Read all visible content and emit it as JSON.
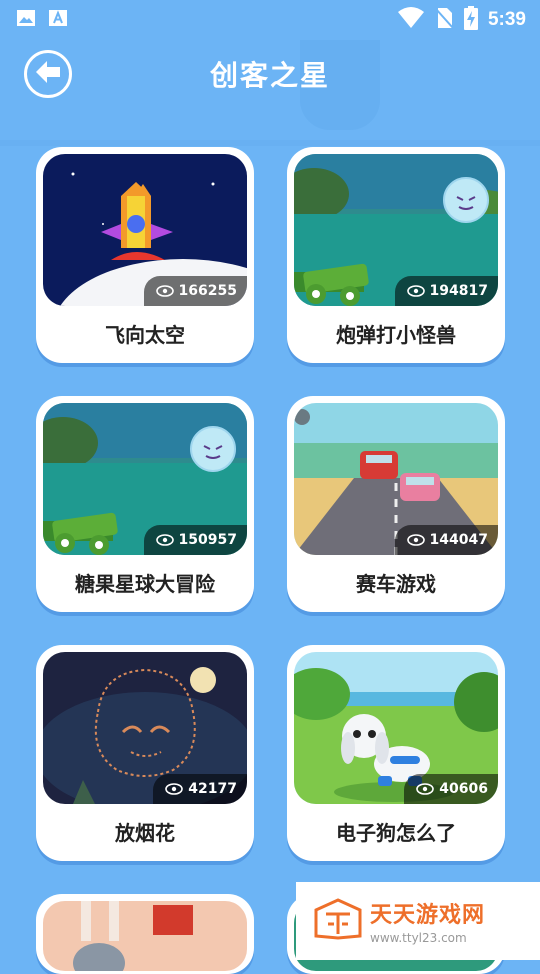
{
  "status_bar": {
    "time": "5:39"
  },
  "header": {
    "title": "创客之星"
  },
  "cards": [
    {
      "title": "飞向太空",
      "views": "166255"
    },
    {
      "title": "炮弹打小怪兽",
      "views": "194817"
    },
    {
      "title": "糖果星球大冒险",
      "views": "150957"
    },
    {
      "title": "赛车游戏",
      "views": "144047"
    },
    {
      "title": "放烟花",
      "views": "42177"
    },
    {
      "title": "电子狗怎么了",
      "views": "40606"
    }
  ],
  "watermark": {
    "title": "天天游戏网",
    "url": "www.ttyl23.com"
  },
  "colors": {
    "background": "#6cb4f5",
    "card": "#ffffff",
    "accent": "#ee6f2a"
  }
}
